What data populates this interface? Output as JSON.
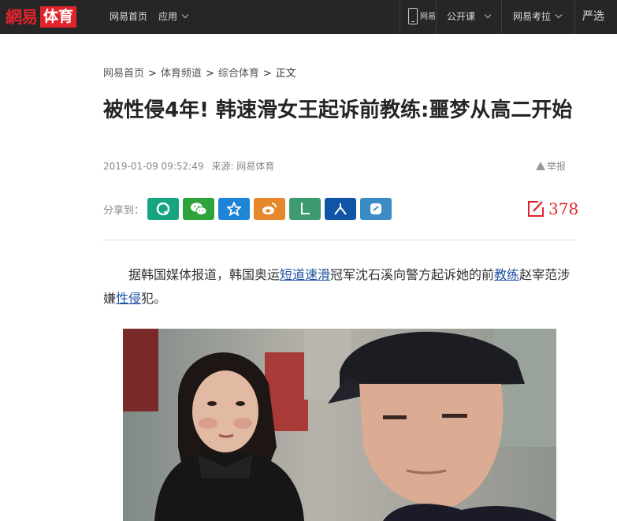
{
  "topbar": {
    "logo_brand": "網易",
    "logo_channel": "体育",
    "home_link": "网易首页",
    "apps_menu": "应用",
    "mobile_label": "网易",
    "course_menu": "公开课",
    "exam_menu": "网易考拉",
    "yanxuan_menu": "严选"
  },
  "breadcrumb": {
    "items": [
      "网易首页",
      "体育频道",
      "综合体育",
      "正文"
    ],
    "separator": ">"
  },
  "article": {
    "title": "被性侵4年! 韩速滑女王起诉前教练:噩梦从高二开始",
    "timestamp": "2019-01-09 09:52:49",
    "source": "来源: 网易体育",
    "report_label": "举报",
    "share_label": "分享到：",
    "comment_count": "378",
    "paragraph": {
      "p1": "据韩国媒体报道，韩国奥运",
      "link1": "短道速滑",
      "p2": "冠军沈石溪向警方起诉她的前",
      "link2": "教练",
      "p3": "赵宰范涉嫌",
      "link3": "性侵",
      "p4": "犯。"
    }
  },
  "share_buttons": [
    {
      "name": "qq-friend",
      "icon": "qq-icon",
      "color": "#16a57f"
    },
    {
      "name": "wechat",
      "icon": "wechat-icon",
      "color": "#2fa33b"
    },
    {
      "name": "qzone",
      "icon": "qzone-star-icon",
      "color": "#1e84d6"
    },
    {
      "name": "weibo",
      "icon": "weibo-icon",
      "color": "#e7872b"
    },
    {
      "name": "lofter",
      "icon": "lofter-icon",
      "color": "#3e9a70"
    },
    {
      "name": "renren",
      "icon": "renren-icon",
      "color": "#1055a5"
    },
    {
      "name": "yixin",
      "icon": "yixin-icon",
      "color": "#3b8bc4"
    }
  ],
  "colors": {
    "brand_red": "#e1242c",
    "topbar_bg": "#262626",
    "link_blue": "#1e50a2"
  }
}
